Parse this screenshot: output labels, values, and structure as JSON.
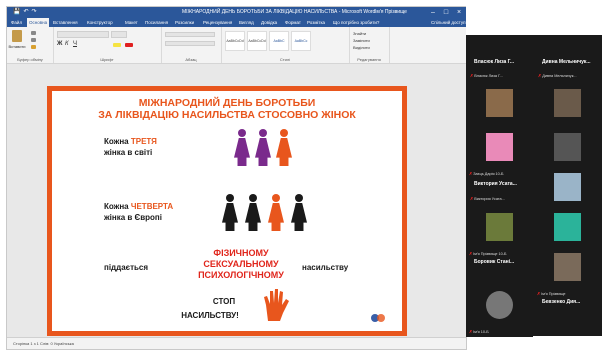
{
  "word": {
    "title": "МІЖНАРОДНИЙ ДЕНЬ БОРОТЬБИ ЗА ЛІКВІДАЦІЮ НАСИЛЬСТВА - Microsoft Word",
    "user": "Ім'я Прізвище",
    "tabs": [
      "Файл",
      "Основна",
      "Вставлення",
      "Конструктор",
      "Макет",
      "Посилання",
      "Розсилки",
      "Рецензування",
      "Вигляд",
      "Довідка",
      "Формат",
      "Розмітка",
      "Що потрібно зробити?"
    ],
    "share": "Спільний доступ",
    "ribbon": {
      "paste": "Вставити",
      "clipboard": "Буфер обміну",
      "font": "Шрифт",
      "paragraph": "Абзац",
      "styles": "Стилі",
      "editing": "Редагування",
      "find": "Знайти",
      "replace": "Замінити",
      "select": "Виділити",
      "style_names": [
        "AaBbCcDd",
        "AaBbCcDd",
        "AaBbC",
        "AaBbCc"
      ]
    },
    "status": "Сторінка 1 з 1   Слів: 0   Українська"
  },
  "slide": {
    "title_line1": "МІЖНАРОДНИЙ ДЕНЬ БОРОТЬБИ",
    "title_line2": "ЗА ЛІКВІДАЦІЮ НАСИЛЬСТВА СТОСОВНО ЖІНОК",
    "third_a": "Кожна ",
    "third_b": "ТРЕТЯ",
    "third_c": "жінка в світі",
    "fourth_a": "Кожна ",
    "fourth_b": "ЧЕТВЕРТА",
    "fourth_c": "жінка в Європі",
    "subjected": "піддається",
    "forms": [
      "ФІЗИЧНОМУ",
      "СЕКСУАЛЬНОМУ",
      "ПСИХОЛОГІЧНОМУ"
    ],
    "violence": "насильству",
    "stop1": "СТОП",
    "stop2": "НАСИЛЬСТВУ!",
    "colors": {
      "accent": "#e8561d",
      "purple": "#7a2a8c",
      "red": "#e0251b",
      "dark": "#1a1a1a"
    }
  },
  "participants": [
    {
      "name": "Власюк Лиза Г...",
      "label": "Власюк Лиза Г...",
      "has_photo": false
    },
    {
      "name": "Дивна Мельничук...",
      "label": "Дивна Мельничук...",
      "has_photo": false
    },
    {
      "name": "",
      "label": "Ім'я Прізвище 10-Б",
      "has_photo": true,
      "color": "#8a6a4a"
    },
    {
      "name": "",
      "label": "Ім'я Прізвище 10-Б",
      "has_photo": true,
      "color": "#6a5a4a"
    },
    {
      "name": "",
      "label": "Заєць Дарія 10-Б",
      "has_photo": true,
      "color": "#e98ab8"
    },
    {
      "name": "",
      "label": "10-Б Прізвище",
      "has_photo": true,
      "color": "#555"
    },
    {
      "name": "Виктория Усата...",
      "label": "Виктория Усата...",
      "has_photo": false
    },
    {
      "name": "",
      "label": "",
      "has_photo": true,
      "color": "#9ab4c8"
    },
    {
      "name": "",
      "label": "Ім'я Прізвище 10-Б",
      "has_photo": true,
      "color": "#6b7a3a"
    },
    {
      "name": "",
      "label": "Ім'я Прізвище",
      "has_photo": true,
      "color": "#2bb39a"
    },
    {
      "name": "Боровик Стані...",
      "label": "Боровик Стані...",
      "has_photo": false
    },
    {
      "name": "",
      "label": "Ім'я Прізвище",
      "has_photo": true,
      "color": "#7a6a5a"
    },
    {
      "name": "",
      "label": "Ім'я 10-Б",
      "has_photo": true,
      "color": "#777"
    },
    {
      "name": "Бевзенко Дия...",
      "label": "Бевзенко Дия...",
      "has_photo": false
    }
  ]
}
